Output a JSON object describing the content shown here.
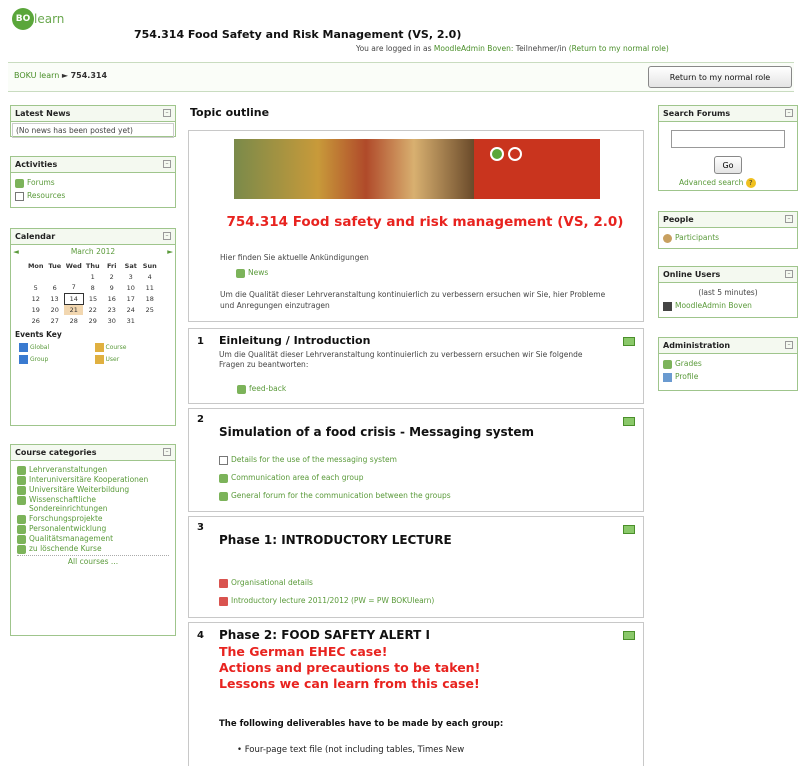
{
  "header": {
    "logo_text": "learn",
    "logo_mark": "BO",
    "course_title": "754.314 Food Safety and Risk Management (VS, 2.0)",
    "login_prefix": "You are logged in as",
    "login_user": "MoodleAdmin Boven:",
    "login_role": "Teilnehmer/in",
    "login_return": "(Return to my normal role)"
  },
  "navbar": {
    "crumb_home": "BOKU learn",
    "crumb_sep": "►",
    "crumb_current": "754.314",
    "return_button": "Return to my normal role"
  },
  "left": {
    "latest_news": {
      "title": "Latest News",
      "text": "(No news has been posted yet)"
    },
    "activities": {
      "title": "Activities",
      "items": [
        {
          "label": "Forums",
          "icon": "forum-icon"
        },
        {
          "label": "Resources",
          "icon": "resource-icon"
        }
      ]
    },
    "calendar": {
      "title": "Calendar",
      "prev": "◄",
      "month": "March 2012",
      "next": "►",
      "days": [
        "Mon",
        "Tue",
        "Wed",
        "Thu",
        "Fri",
        "Sat",
        "Sun"
      ],
      "weeks": [
        [
          "",
          "",
          "",
          "1",
          "2",
          "3",
          "4"
        ],
        [
          "5",
          "6",
          "7",
          "8",
          "9",
          "10",
          "11"
        ],
        [
          "12",
          "13",
          "14",
          "15",
          "16",
          "17",
          "18"
        ],
        [
          "19",
          "20",
          "21",
          "22",
          "23",
          "24",
          "25"
        ],
        [
          "26",
          "27",
          "28",
          "29",
          "30",
          "31",
          ""
        ]
      ],
      "events_key": "Events Key",
      "keys": [
        "Global",
        "Course",
        "Group",
        "User"
      ]
    },
    "categories": {
      "title": "Course categories",
      "items": [
        "Lehrveranstaltungen",
        "Interuniversitäre Kooperationen",
        "Universitäre Weiterbildung",
        "Wissenschaftliche Sondereinrichtungen",
        "Forschungsprojekte",
        "Personalentwicklung",
        "Qualitätsmanagement",
        "zu löschende Kurse"
      ],
      "all": "All courses ..."
    }
  },
  "right": {
    "search": {
      "title": "Search Forums",
      "go": "Go",
      "advanced": "Advanced search"
    },
    "people": {
      "title": "People",
      "item": "Participants"
    },
    "online": {
      "title": "Online Users",
      "sub": "(last 5 minutes)",
      "user": "MoodleAdmin Boven"
    },
    "admin": {
      "title": "Administration",
      "items": [
        "Grades",
        "Profile"
      ]
    }
  },
  "main": {
    "topic_title": "Topic outline",
    "s0": {
      "heading": "754.314 Food safety and risk management (VS, 2.0)",
      "intro": "Hier finden Sie aktuelle Ankündigungen",
      "news": "News",
      "note": "Um die Qualität dieser Lehrveranstaltung kontinuierlich zu verbessern ersuchen wir Sie, hier Probleme und Anregungen einzutragen"
    },
    "s1": {
      "num": "1",
      "title": "Einleitung / Introduction",
      "text": "Um die Qualität dieser Lehrveranstaltung kontinuierlich zu verbessern ersuchen wir Sie folgende Fragen zu beantworten:",
      "link": "feed-back"
    },
    "s2": {
      "num": "2",
      "title": "Simulation of a food crisis - Messaging system",
      "links": [
        "Details for the use of the messaging system",
        "Communication area of each group",
        "General forum for the communication between the groups"
      ]
    },
    "s3": {
      "num": "3",
      "title": "Phase 1: INTRODUCTORY LECTURE",
      "links": [
        "Organisational details",
        "Introductory lecture 2011/2012 (PW = PW BOKUlearn)"
      ]
    },
    "s4": {
      "num": "4",
      "title": "Phase 2: FOOD SAFETY ALERT I",
      "red1": "The German EHEC case!",
      "red2": "Actions and precautions to be taken!",
      "red3": "Lessons we can learn from this case!",
      "deliverables": "The following deliverables have to be made by each group:",
      "bullet": "Four-page text file (not including tables, Times New"
    }
  }
}
